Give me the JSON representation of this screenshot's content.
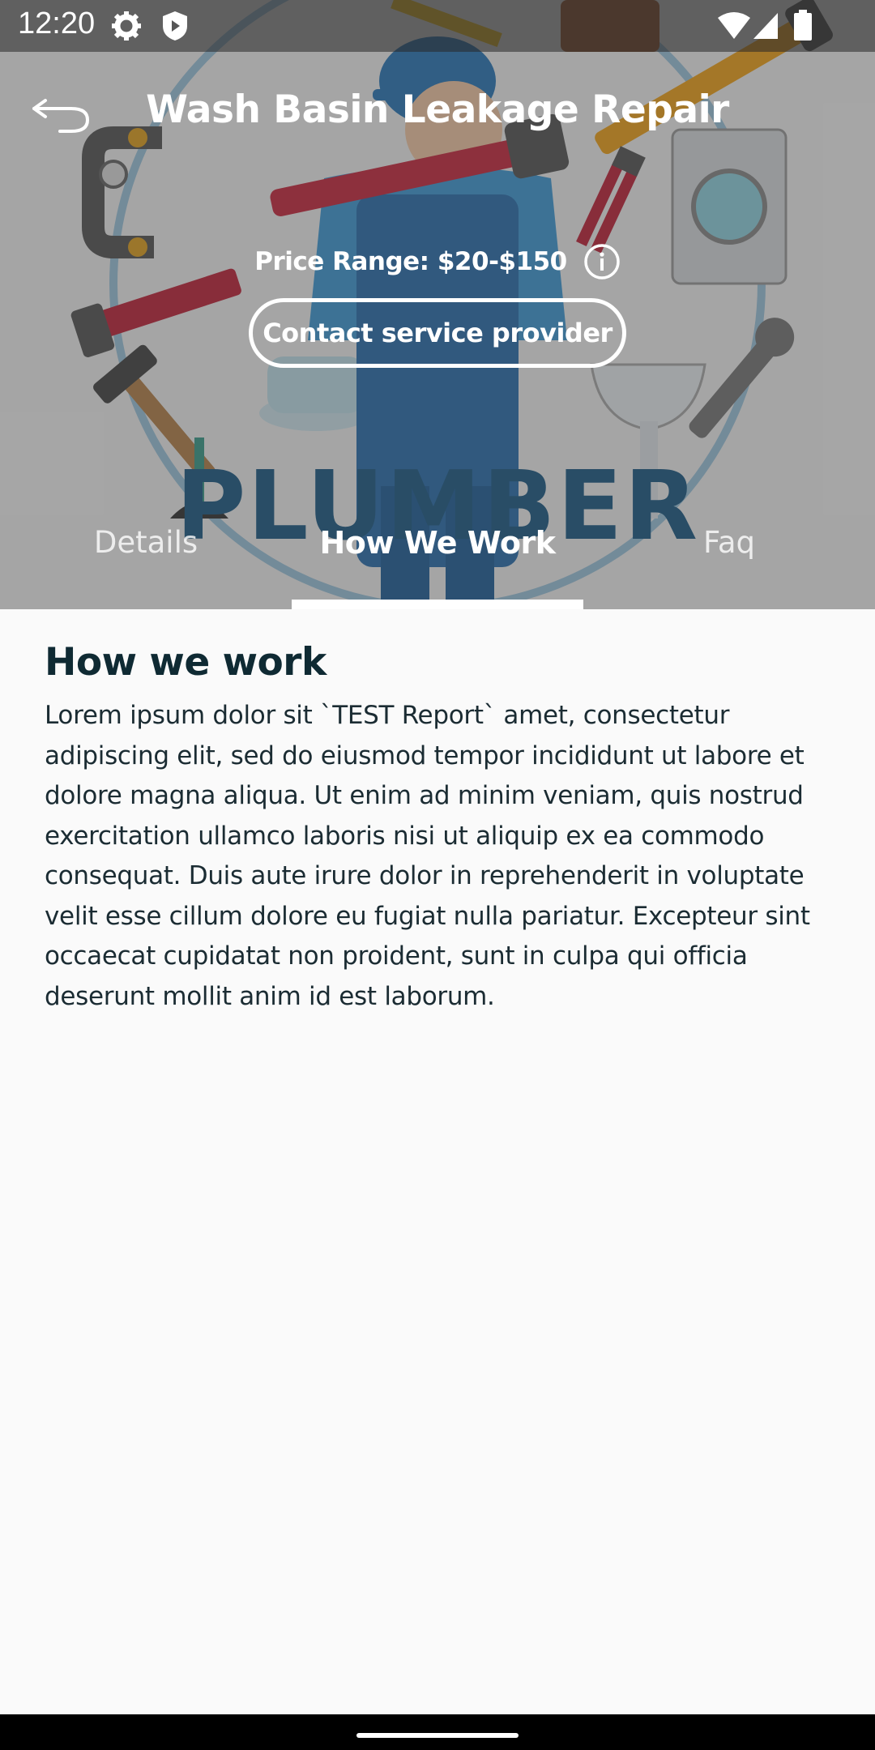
{
  "status_bar": {
    "time": "12:20",
    "icons": [
      "gear-icon",
      "shield-icon",
      "wifi-icon",
      "signal-icon",
      "battery-icon"
    ]
  },
  "header": {
    "title": "Wash Basin Leakage Repair",
    "back_icon": "back-arrow-icon"
  },
  "hero": {
    "image_description_word": "PLUMBER",
    "price_range": "Price Range: $20-$150",
    "info_icon": "info-icon",
    "contact_button": "Contact service provider"
  },
  "tabs": [
    {
      "label": "Details",
      "selected": false
    },
    {
      "label": "How We Work",
      "selected": true
    },
    {
      "label": "Faq",
      "selected": false
    }
  ],
  "content": {
    "heading": "How we work",
    "body": "Lorem ipsum dolor sit `TEST Report` amet, consectetur adipiscing elit, sed do eiusmod tempor incididunt ut labore et dolore magna aliqua. Ut enim ad minim veniam, quis nostrud exercitation ullamco laboris nisi ut aliquip ex ea commodo consequat. Duis aute irure dolor in reprehenderit in voluptate velit esse cillum dolore eu fugiat nulla pariatur. Excepteur sint occaecat cupidatat non proident, sunt in culpa qui officia deserunt mollit anim id est laborum."
  },
  "colors": {
    "heading": "#0f2a33",
    "body_text": "#1b2c33",
    "background": "#fafafa",
    "overlay": "#3c3c3c"
  }
}
